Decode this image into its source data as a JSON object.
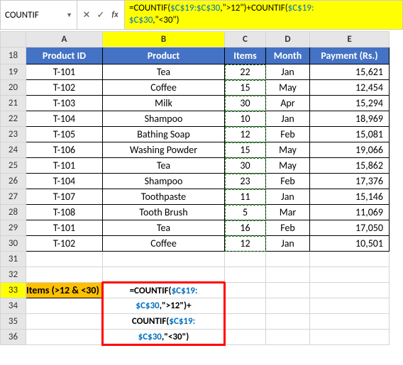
{
  "nameBox": "COUNTIF",
  "formulaBar": {
    "prefix": "=COUNTIF(",
    "range1": "$C$19:$C$30",
    "mid1": ",\">12\")+COUNTIF(",
    "range2": "$C$19:",
    "line2range": "$C$30",
    "suffix": ",\"<30\")"
  },
  "columns": [
    "A",
    "B",
    "C",
    "D",
    "E"
  ],
  "headers": {
    "productId": "Product ID",
    "product": "Product",
    "items": "Items",
    "month": "Month",
    "payment": "Payment (Rs.)"
  },
  "rows": [
    {
      "n": 19,
      "id": "T-101",
      "prod": "Tea",
      "items": "22",
      "month": "Jan",
      "pay": "15,621"
    },
    {
      "n": 20,
      "id": "T-102",
      "prod": "Coffee",
      "items": "15",
      "month": "May",
      "pay": "12,454"
    },
    {
      "n": 21,
      "id": "T-103",
      "prod": "Milk",
      "items": "30",
      "month": "Apr",
      "pay": "15,294"
    },
    {
      "n": 22,
      "id": "T-104",
      "prod": "Shampoo",
      "items": "10",
      "month": "Jan",
      "pay": "18,969"
    },
    {
      "n": 23,
      "id": "T-105",
      "prod": "Bathing Soap",
      "items": "12",
      "month": "Feb",
      "pay": "15,081"
    },
    {
      "n": 24,
      "id": "T-106",
      "prod": "Washing Powder",
      "items": "15",
      "month": "May",
      "pay": "19,066"
    },
    {
      "n": 25,
      "id": "T-101",
      "prod": "Tea",
      "items": "30",
      "month": "May",
      "pay": "15,862"
    },
    {
      "n": 26,
      "id": "T-104",
      "prod": "Shampoo",
      "items": "23",
      "month": "Feb",
      "pay": "17,376"
    },
    {
      "n": 27,
      "id": "T-107",
      "prod": "Toothpaste",
      "items": "11",
      "month": "Jan",
      "pay": "15,146"
    },
    {
      "n": 28,
      "id": "T-108",
      "prod": "Tooth Brush",
      "items": "5",
      "month": "Mar",
      "pay": "11,069"
    },
    {
      "n": 29,
      "id": "T-101",
      "prod": "Tea",
      "items": "16",
      "month": "Feb",
      "pay": "17,050"
    },
    {
      "n": 30,
      "id": "T-102",
      "prod": "Coffee",
      "items": "12",
      "month": "Jan",
      "pay": "10,501"
    }
  ],
  "label33": "Items (>12 & <30)",
  "formulaDisplay": {
    "l1a": "=COUNTIF(",
    "l1b": "$C$19:",
    "l2a": "$C$30",
    "l2b": ",\">12\")+",
    "l3a": "COUNTIF(",
    "l3b": "$C$19:",
    "l4a": "$C$30",
    "l4b": ",\"<30\")"
  },
  "rowNums": {
    "r31": "31",
    "r32": "32",
    "r33": "33",
    "r34": "34",
    "r35": "35",
    "r36": "36",
    "r18": "18"
  }
}
